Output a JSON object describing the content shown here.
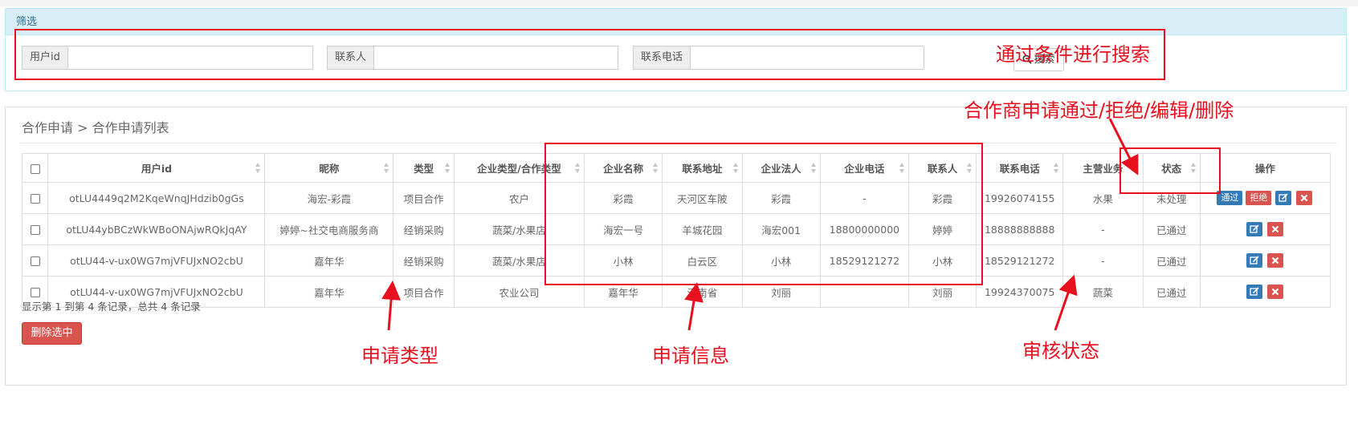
{
  "filter": {
    "title": "筛选",
    "fields": [
      {
        "label": "用户id",
        "value": ""
      },
      {
        "label": "联系人",
        "value": ""
      },
      {
        "label": "联系电话",
        "value": ""
      }
    ],
    "search_label": "搜索"
  },
  "breadcrumb": {
    "text": "合作申请 > 合作申请列表"
  },
  "table": {
    "headers": [
      "用户id",
      "昵称",
      "类型",
      "企业类型/合作类型",
      "企业名称",
      "联系地址",
      "企业法人",
      "企业电话",
      "联系人",
      "联系电话",
      "主营业务",
      "状态",
      "操作"
    ],
    "rows": [
      {
        "cells": [
          "otLU4449q2M2KqeWnqJHdzib0gGs",
          "海宏-彩霞",
          "项目合作",
          "农户",
          "彩霞",
          "天河区车陂",
          "彩霞",
          "-",
          "彩霞",
          "19926074155",
          "水果",
          "未处理"
        ],
        "actions": [
          "通过",
          "拒绝"
        ]
      },
      {
        "cells": [
          "otLU44ybBCzWkWBoONAjwRQkJqAY",
          "婷婷~社交电商服务商",
          "经销采购",
          "蔬菜/水果店",
          "海宏一号",
          "羊城花园",
          "海宏001",
          "18800000000",
          "婷婷",
          "18888888888",
          "-",
          "已通过"
        ],
        "actions": []
      },
      {
        "cells": [
          "otLU44-v-ux0WG7mjVFUJxNO2cbU",
          "嘉年华",
          "经销采购",
          "蔬菜/水果店",
          "小林",
          "白云区",
          "小林",
          "18529121272",
          "小林",
          "18529121272",
          "-",
          "已通过"
        ],
        "actions": []
      },
      {
        "cells": [
          "otLU44-v-ux0WG7mjVFUJxNO2cbU",
          "嘉年华",
          "项目合作",
          "农业公司",
          "嘉年华",
          "河南省",
          "刘丽",
          "",
          "刘丽",
          "19924370075",
          "蔬菜",
          "已通过"
        ],
        "actions": []
      }
    ]
  },
  "summary": "显示第 1 到第 4 条记录，总共 4 条记录",
  "delete_selected": "删除选中",
  "annotations": {
    "search": "通过条件进行搜索",
    "actions": "合作商申请通过/拒绝/编辑/删除",
    "type": "申请类型",
    "info": "申请信息",
    "status": "审核状态"
  },
  "colors": {
    "annotation": "#e8101e",
    "primary": "#337ab7",
    "danger": "#d9534f",
    "panel_head": "#d9edf7"
  }
}
